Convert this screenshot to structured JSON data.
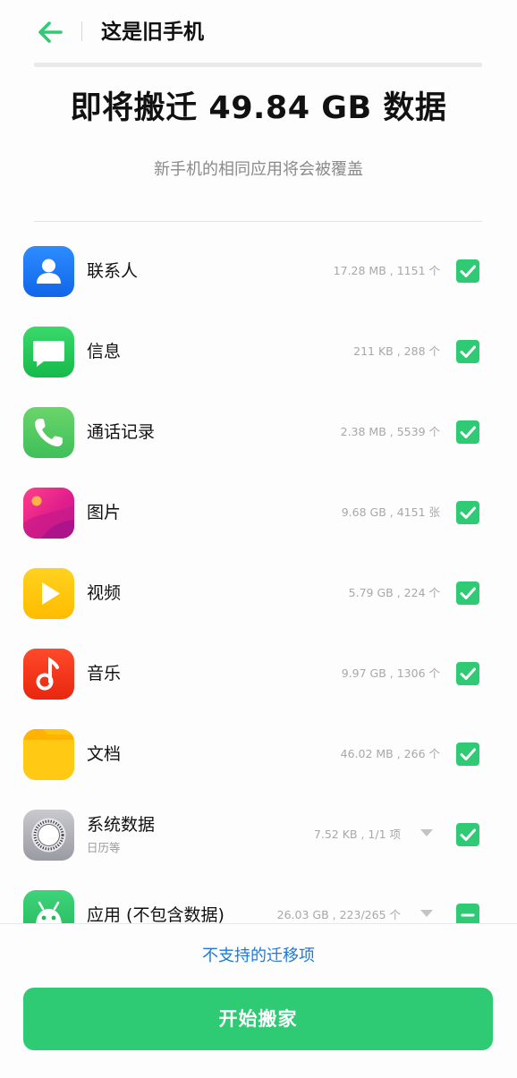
{
  "header": {
    "title": "这是旧手机"
  },
  "headline": "即将搬迁 49.84 GB 数据",
  "subtitle": "新手机的相同应用将会被覆盖",
  "items": [
    {
      "name": "联系人",
      "meta": "17.28 MB , 1151 个",
      "icon": "contacts-icon",
      "checked": true
    },
    {
      "name": "信息",
      "meta": "211 KB , 288 个",
      "icon": "messages-icon",
      "checked": true
    },
    {
      "name": "通话记录",
      "meta": "2.38 MB , 5539 个",
      "icon": "phone-icon",
      "checked": true
    },
    {
      "name": "图片",
      "meta": "9.68 GB , 4151 张",
      "icon": "photos-icon",
      "checked": true
    },
    {
      "name": "视频",
      "meta": "5.79 GB , 224 个",
      "icon": "video-icon",
      "checked": true
    },
    {
      "name": "音乐",
      "meta": "9.97 GB , 1306 个",
      "icon": "music-icon",
      "checked": true
    },
    {
      "name": "文档",
      "meta": "46.02 MB , 266 个",
      "icon": "documents-icon",
      "checked": true
    },
    {
      "name": "系统数据",
      "sub": "日历等",
      "meta": "7.52 KB , 1/1 项",
      "icon": "system-data-icon",
      "checked": true
    },
    {
      "name": "应用 (不包含数据)",
      "meta": "26.03 GB , 223/265 个",
      "icon": "android-app-icon",
      "checked": "partial"
    }
  ],
  "footer": {
    "unsupported_link": "不支持的迁移项",
    "start_button": "开始搬家"
  },
  "colors": {
    "accent_green": "#2ecb74",
    "link_blue": "#1f7ad6"
  }
}
